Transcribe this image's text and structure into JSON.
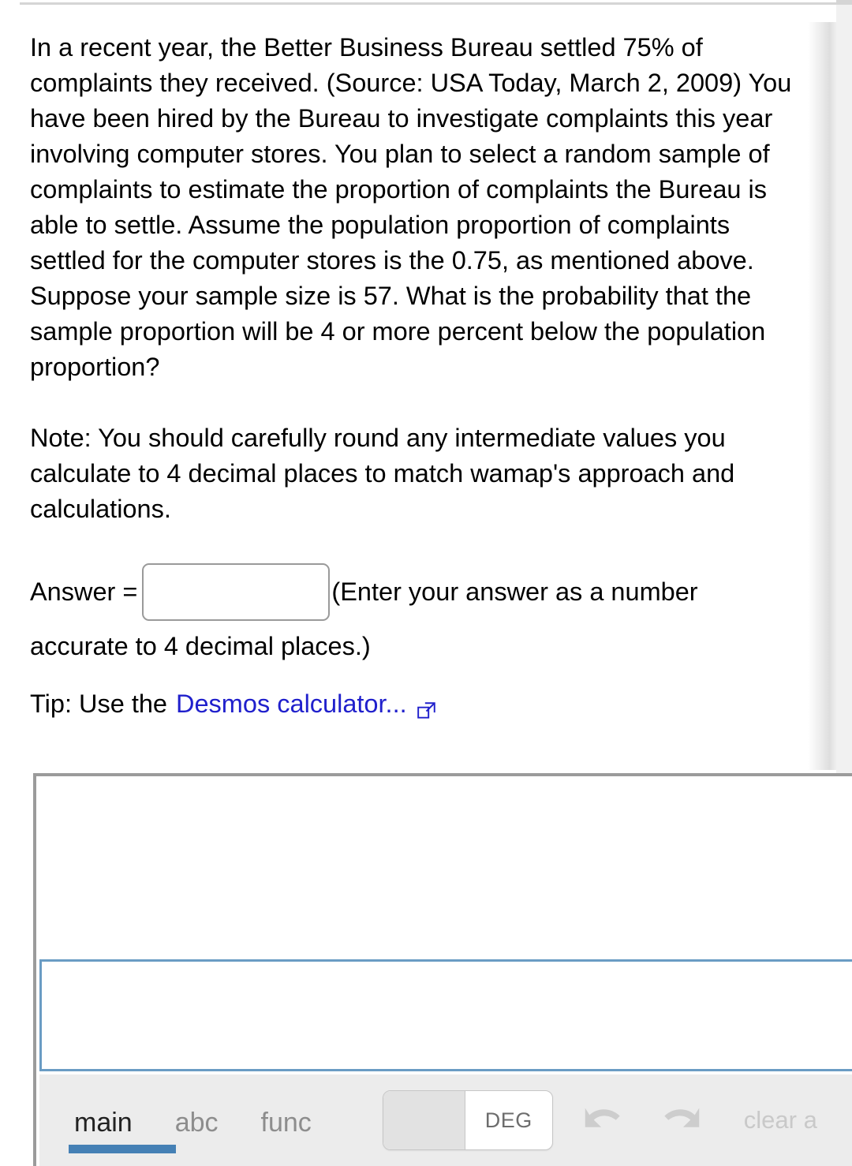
{
  "question": {
    "paragraph_1": "In a recent year, the Better Business Bureau settled 75% of complaints they received. (Source: USA Today, March 2, 2009) You have been hired by the Bureau to investigate complaints this year involving computer stores. You plan to select a random sample of complaints to estimate the proportion of complaints the Bureau is able to settle. Assume the population proportion of complaints settled for the computer stores is the 0.75, as mentioned above. Suppose your sample size is 57. What is the probability that the sample proportion will be 4 or more percent below the population proportion?",
    "paragraph_2": "Note: You should carefully round any intermediate values you calculate to 4 decimal places to match wamap's approach and calculations.",
    "answer_label": "Answer =",
    "answer_value": "",
    "answer_placeholder": "",
    "answer_hint_1": "(Enter your answer as a number",
    "answer_hint_2": "accurate to 4 decimal places.)",
    "tip_prefix": "Tip: Use the",
    "tip_link_text": "Desmos calculator...",
    "external_link_icon": "external-link-icon",
    "link_color": "#2020cc"
  },
  "calculator": {
    "history_value": "",
    "input_value": "",
    "toolbar": {
      "tabs": [
        {
          "label": "main",
          "active": true
        },
        {
          "label": "abc",
          "active": false
        },
        {
          "label": "func",
          "active": false
        }
      ],
      "angle_toggle": {
        "left_label": "",
        "right_label": "DEG",
        "selected": "DEG"
      },
      "undo_icon": "undo-icon",
      "redo_icon": "redo-icon",
      "clear_label": "clear a",
      "active_tab_color": "#4580b5",
      "toolbar_bg": "#ececec",
      "input_border_color": "#6a9cc4",
      "panel_border_color": "#9b9b9b"
    }
  }
}
